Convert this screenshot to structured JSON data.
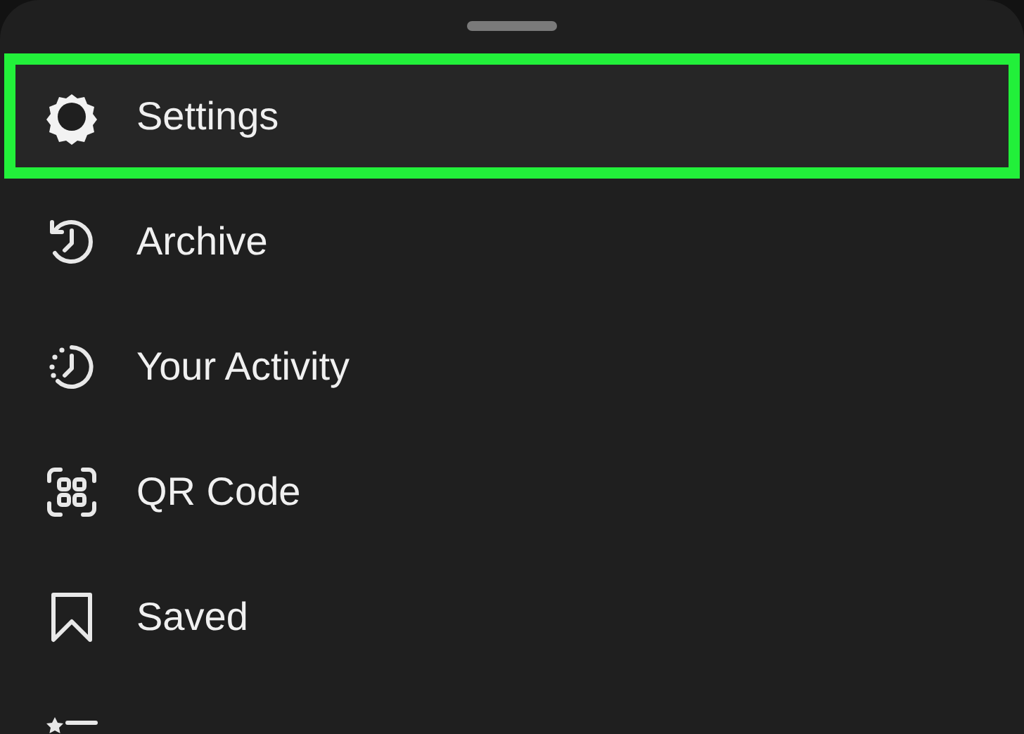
{
  "menu": {
    "items": [
      {
        "kind": "settings",
        "label": "Settings",
        "selected": true
      },
      {
        "kind": "archive",
        "label": "Archive",
        "selected": false
      },
      {
        "kind": "activity",
        "label": "Your Activity",
        "selected": false
      },
      {
        "kind": "qr",
        "label": "QR Code",
        "selected": false
      },
      {
        "kind": "saved",
        "label": "Saved",
        "selected": false
      },
      {
        "kind": "close-friends",
        "selected": false
      }
    ]
  }
}
